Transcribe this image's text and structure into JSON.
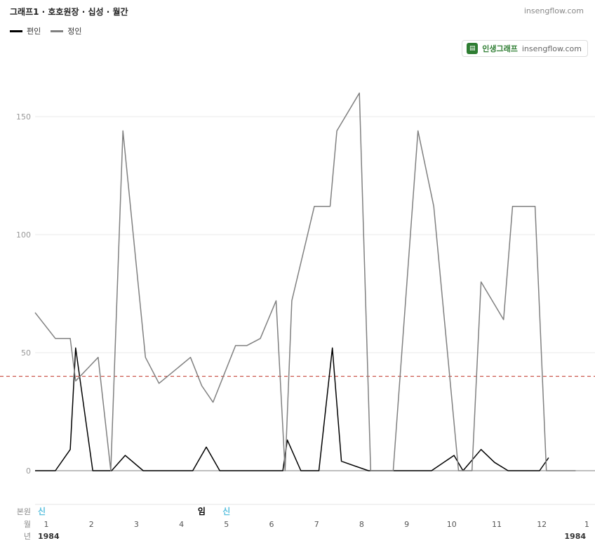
{
  "header": {
    "title": "그래프1 · 호호원장 · 십성 · 월간",
    "site": "insengflow.com"
  },
  "badge": {
    "brand": "인생그래프",
    "site": "insengflow.com"
  },
  "colors": {
    "series1": "#000000",
    "series2": "#808080",
    "reference": "#c0392b",
    "annot_blue": "#5bc0de",
    "annot_black": "#000000"
  },
  "chart_data": {
    "type": "line",
    "y_ticks": [
      0,
      50,
      100,
      150
    ],
    "ylim": [
      -5,
      175
    ],
    "xlim": [
      0,
      12.2
    ],
    "reference_line": 40,
    "series": [
      {
        "name": "편인",
        "x": [
          0.0,
          0.45,
          0.78,
          0.9,
          1.28,
          1.55,
          1.7,
          2.0,
          2.4,
          2.75,
          3.0,
          3.5,
          3.8,
          4.1,
          4.5,
          4.95,
          5.5,
          5.6,
          5.9,
          6.1,
          6.3,
          6.6,
          6.8,
          7.4,
          8.8,
          9.3,
          9.5,
          9.9,
          10.2,
          10.5,
          10.8,
          11.2,
          11.4
        ],
        "y": [
          0,
          0,
          9,
          52,
          0,
          0,
          0,
          6.5,
          0,
          0,
          0,
          0,
          10,
          0,
          0,
          0,
          0,
          13,
          0,
          0,
          0,
          52,
          4,
          0,
          0,
          6.5,
          0,
          9,
          3.5,
          0,
          0,
          0,
          5.5
        ]
      },
      {
        "name": "정인",
        "x": [
          0.0,
          0.45,
          0.78,
          0.9,
          1.4,
          1.68,
          1.95,
          2.45,
          2.75,
          3.45,
          3.7,
          3.95,
          4.45,
          4.7,
          5.0,
          5.35,
          5.55,
          5.7,
          6.2,
          6.55,
          6.7,
          7.2,
          7.45,
          7.75,
          7.95,
          8.5,
          8.85,
          9.4,
          9.55,
          9.7,
          9.9,
          10.4,
          10.6,
          11.1,
          11.35,
          12.0
        ],
        "y": [
          67,
          56,
          56,
          38,
          48,
          0,
          144,
          48,
          37,
          48,
          36,
          29,
          53,
          53,
          56,
          72,
          0,
          72,
          112,
          112,
          144,
          160,
          0,
          0,
          0,
          144,
          112,
          0,
          0,
          0,
          80,
          64,
          112,
          112,
          0,
          0
        ]
      }
    ],
    "x_row_labels": [
      "본원",
      "월",
      "년"
    ],
    "months": [
      {
        "label": "1",
        "x": 0.0
      },
      {
        "label": "2",
        "x": 1.0
      },
      {
        "label": "3",
        "x": 2.0
      },
      {
        "label": "4",
        "x": 3.0
      },
      {
        "label": "5",
        "x": 4.0
      },
      {
        "label": "6",
        "x": 5.0
      },
      {
        "label": "7",
        "x": 6.0
      },
      {
        "label": "8",
        "x": 7.0
      },
      {
        "label": "9",
        "x": 8.0
      },
      {
        "label": "10",
        "x": 9.0
      },
      {
        "label": "11",
        "x": 10.0
      },
      {
        "label": "12",
        "x": 11.0
      },
      {
        "label": "1",
        "x": 12.0
      }
    ],
    "years": [
      {
        "label": "1984",
        "x": 0.0
      },
      {
        "label": "1984",
        "x": 12.0
      }
    ],
    "annotations": [
      {
        "label": "신",
        "x": 0.0,
        "color": "blue"
      },
      {
        "label": "임",
        "x": 3.55,
        "color": "black"
      },
      {
        "label": "신",
        "x": 4.1,
        "color": "blue"
      }
    ]
  }
}
